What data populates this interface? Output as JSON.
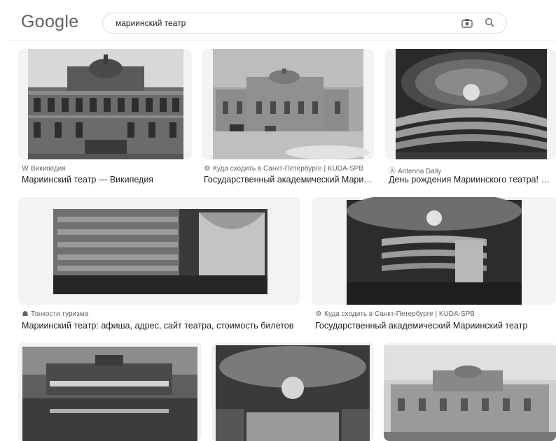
{
  "header": {
    "logo": "Google",
    "search_query": "мариинский театр",
    "camera_icon": "camera-icon",
    "search_icon": "search-icon"
  },
  "results": [
    {
      "source": "Википедия",
      "source_icon": "W",
      "title": "Мариинский театр — Википедия"
    },
    {
      "source": "Куда сходить в Санкт-Петербурге | KUDA-SPB",
      "source_icon": "⚙",
      "title": "Государственный академический Марии..."
    },
    {
      "source": "Antenna Daily",
      "source_icon": "Ⓐ",
      "title": "День рождения Мариинского театра! Ма..."
    },
    {
      "source": "Тонкости туризма",
      "source_icon": "☗",
      "title": "Мариинский театр: афиша, адрес, сайт театра, стоимость билетов"
    },
    {
      "source": "Куда сходить в Санкт-Петербурге | KUDA-SPB",
      "source_icon": "⚙",
      "title": "Государственный академический Мариинский театр"
    }
  ]
}
